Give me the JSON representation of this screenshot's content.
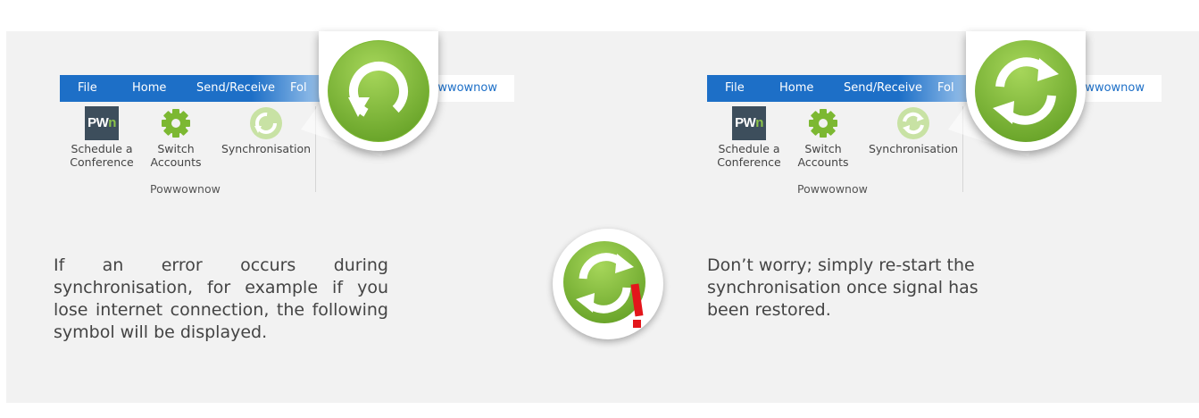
{
  "left_ribbon": {
    "tabs": [
      {
        "label": "File"
      },
      {
        "label": "Home"
      },
      {
        "label": "Send/Receive"
      },
      {
        "label": "Fol"
      },
      {
        "label": "Powwownow"
      }
    ],
    "buttons": [
      {
        "label_line1": "Schedule a",
        "label_line2": "Conference",
        "icon": "powwownow-logo-icon"
      },
      {
        "label_line1": "Switch",
        "label_line2": "Accounts",
        "icon": "gear-icon"
      },
      {
        "label_line1": "Synchronisation",
        "label_line2": "",
        "icon": "sync-icon"
      }
    ],
    "group_label": "Powwownow",
    "logo_text": "PW",
    "logo_accent": "n"
  },
  "right_ribbon": {
    "tabs": [
      {
        "label": "File"
      },
      {
        "label": "Home"
      },
      {
        "label": "Send/Receive"
      },
      {
        "label": "Fol"
      },
      {
        "label": "Powwownow"
      }
    ],
    "buttons": [
      {
        "label_line1": "Schedule a",
        "label_line2": "Conference",
        "icon": "powwownow-logo-icon"
      },
      {
        "label_line1": "Switch",
        "label_line2": "Accounts",
        "icon": "gear-icon"
      },
      {
        "label_line1": "Synchronisation",
        "label_line2": "",
        "icon": "sync-in-progress-icon"
      }
    ],
    "group_label": "Powwownow",
    "logo_text": "PW",
    "logo_accent": "n"
  },
  "text": {
    "left_paragraph": "If an error occurs during synchronisation, for example if you lose internet connection, the following symbol will be displayed.",
    "right_paragraph": "Don’t worry; simply re-start the synchronisation once signal has been restored."
  },
  "colors": {
    "ribbon_blue": "#1d6fc7",
    "sync_green": "#7cb832",
    "error_red": "#e3161b",
    "panel_bg": "#f2f2f2"
  }
}
